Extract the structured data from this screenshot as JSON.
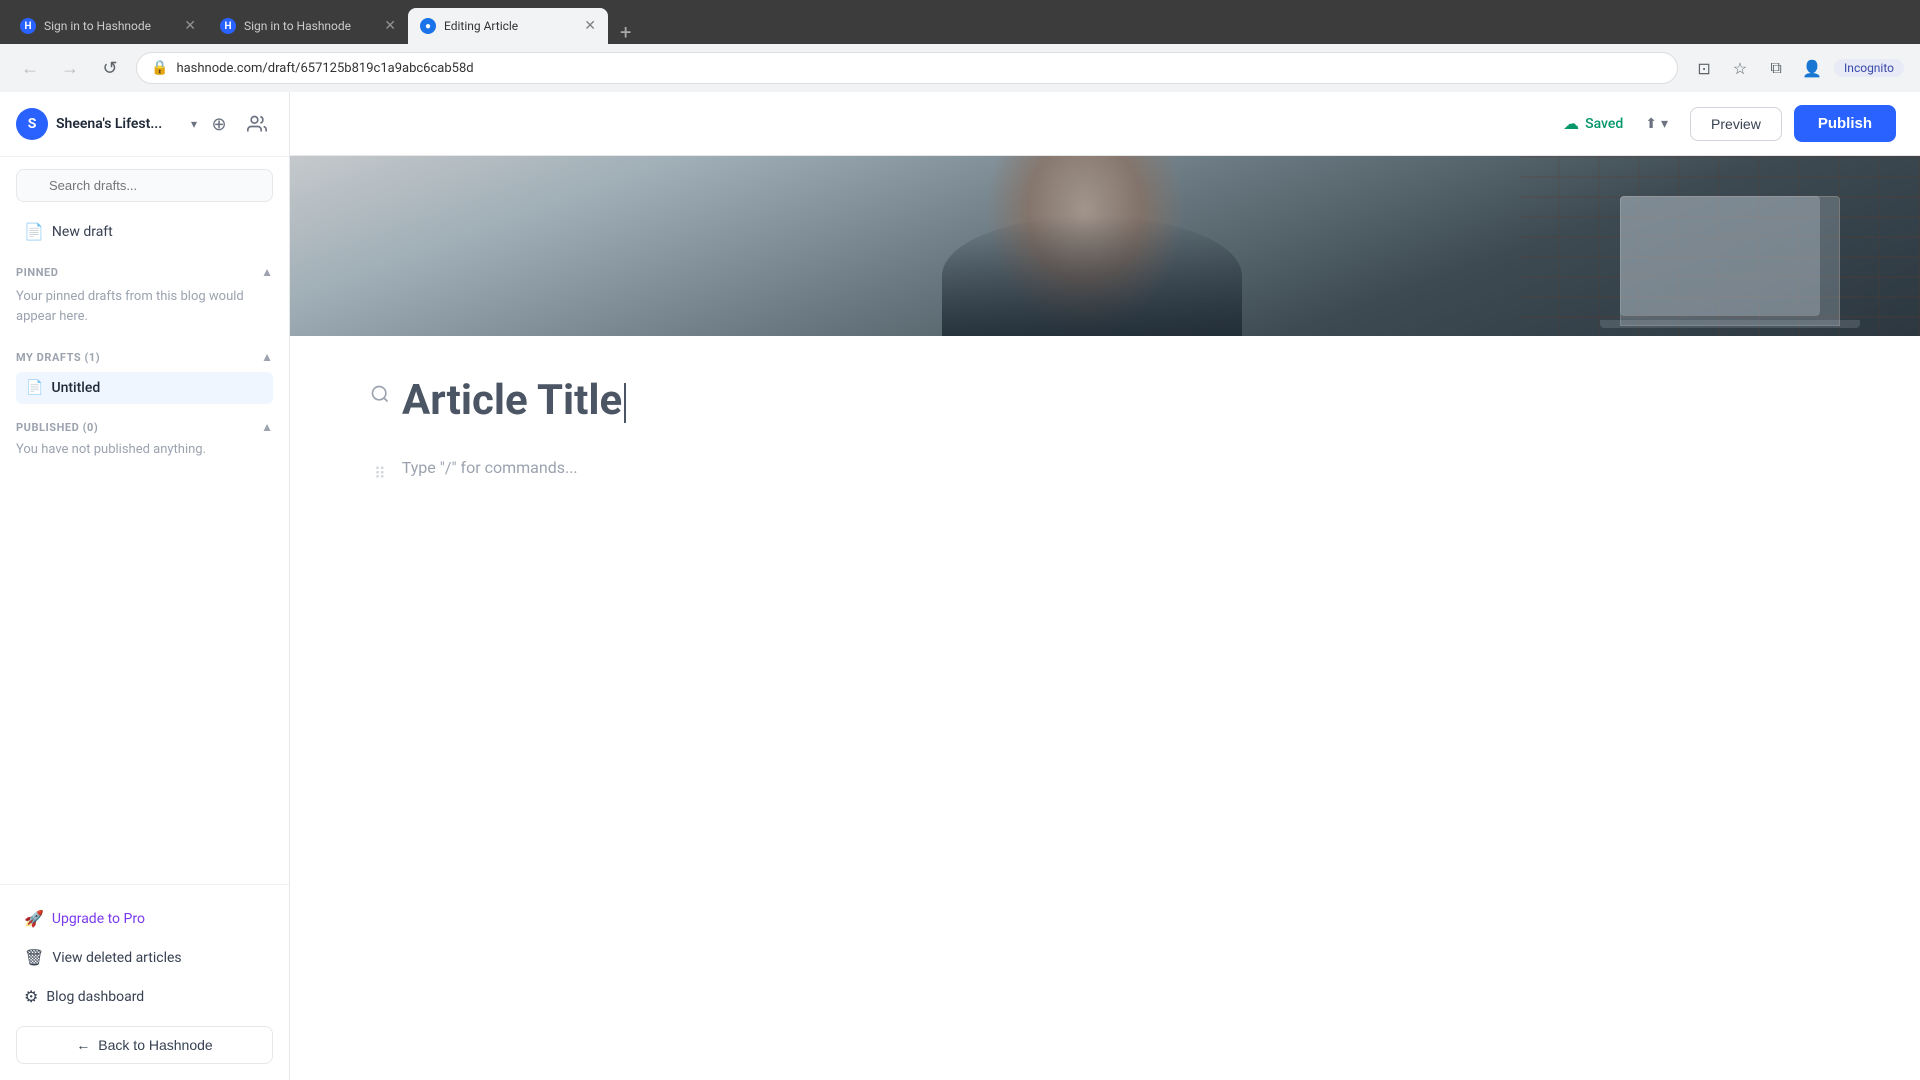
{
  "browser": {
    "tabs": [
      {
        "id": "tab1",
        "title": "Sign in to Hashnode",
        "active": false,
        "favicon": "hashnode"
      },
      {
        "id": "tab2",
        "title": "Sign in to Hashnode",
        "active": false,
        "favicon": "hashnode"
      },
      {
        "id": "tab3",
        "title": "Editing Article",
        "active": true,
        "favicon": "editing"
      }
    ],
    "url": "hashnode.com/draft/657125b819c1a9abc6cab58d",
    "incognito_label": "Incognito"
  },
  "sidebar": {
    "blog_name": "Sheena's Lifest...",
    "search_placeholder": "Search drafts...",
    "new_draft_label": "New draft",
    "pinned_section_title": "PINNED",
    "pinned_empty_text": "Your pinned drafts from this blog would appear here.",
    "my_drafts_section_title": "MY DRAFTS (1)",
    "drafts": [
      {
        "name": "Untitled"
      }
    ],
    "published_section_title": "PUBLISHED (0)",
    "published_empty_text": "You have not published anything.",
    "bottom_links": [
      {
        "label": "Upgrade to Pro",
        "icon": "rocket",
        "type": "upgrade"
      },
      {
        "label": "View deleted articles",
        "icon": "trash"
      },
      {
        "label": "Blog dashboard",
        "icon": "settings"
      }
    ],
    "back_button_label": "Back to Hashnode"
  },
  "toolbar": {
    "saved_label": "Saved",
    "preview_label": "Preview",
    "publish_label": "Publish"
  },
  "editor": {
    "article_title_placeholder": "Article Title",
    "content_placeholder": "Type \"/\" for commands..."
  }
}
